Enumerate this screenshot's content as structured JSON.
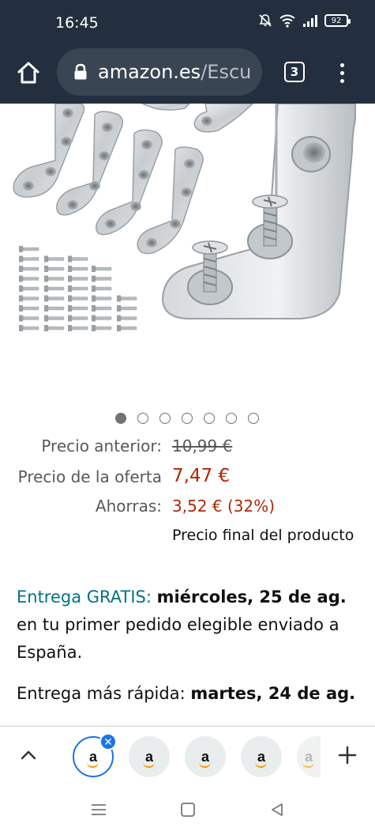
{
  "status_bar": {
    "time": "16:45",
    "battery": "92"
  },
  "browser": {
    "url_host": "amazon.es",
    "url_path": "/Escu",
    "tab_count": "3"
  },
  "carousel": {
    "total": 7,
    "active_index": 0
  },
  "price": {
    "old_label": "Precio anterior:",
    "old_value": "10,99 €",
    "deal_label": "Precio de la oferta",
    "deal_value": "7,47 €",
    "savings_label": "Ahorras:",
    "savings_value": "3,52 € (32%)",
    "final_note": "Precio final del producto"
  },
  "delivery": {
    "free_label": "Entrega GRATIS:",
    "date": "miércoles, 25 de ag.",
    "rest": " en tu primer pedido elegible enviado a España.",
    "fast_label": "Entrega más rápida: ",
    "fast_date": "martes, 24 de ag."
  },
  "tab_strip": {
    "tabs": [
      "a",
      "a",
      "a",
      "a",
      "a"
    ]
  },
  "colors": {
    "header_bg": "#232f3e",
    "price_red": "#b12704",
    "link_teal": "#007185",
    "active_tab_blue": "#1a73e8"
  }
}
